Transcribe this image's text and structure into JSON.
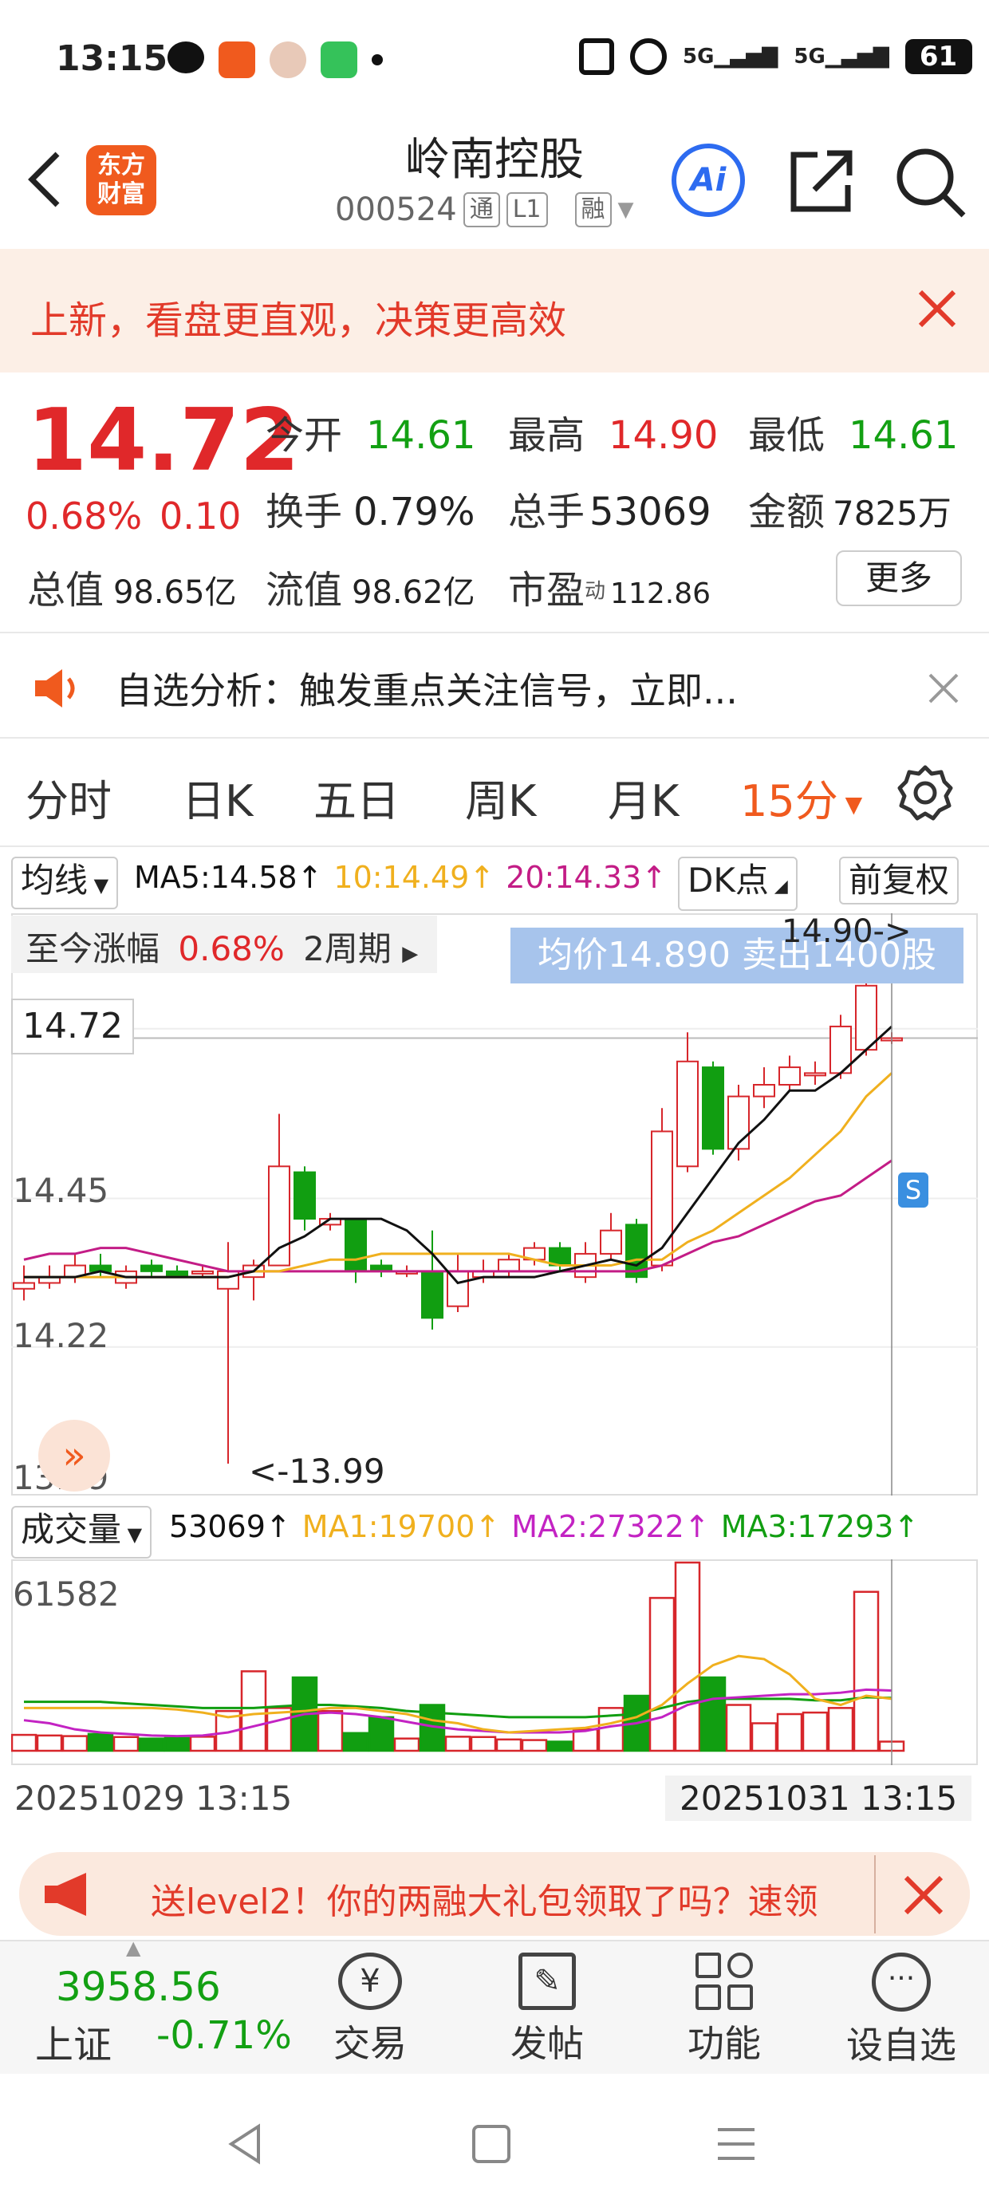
{
  "status_bar": {
    "time": "13:15",
    "battery": "61",
    "network1": "5G",
    "network2": "5G"
  },
  "header": {
    "title": "岭南控股",
    "code": "000524",
    "tag1": "通",
    "tag2": "L1",
    "tag3": "融",
    "ai_label": "Ai",
    "logo_text1": "东方",
    "logo_text2": "财富"
  },
  "promo": {
    "text": "上新，看盘更直观，决策更高效"
  },
  "quote": {
    "price": "14.72",
    "change_pct": "0.68%",
    "change": "0.10",
    "open_label": "今开",
    "open": "14.61",
    "high_label": "最高",
    "high": "14.90",
    "low_label": "最低",
    "low": "14.61",
    "turnover_label": "换手",
    "turnover": "0.79%",
    "volume_label": "总手",
    "volume": "53069",
    "amount_label": "金额",
    "amount": "7825万",
    "mktcap_label": "总值",
    "mktcap": "98.65亿",
    "float_label": "流值",
    "float": "98.62亿",
    "pe_label": "市盈",
    "pe_sup": "动",
    "pe": "112.86",
    "more_label": "更多"
  },
  "notice": {
    "text": "自选分析：触发重点关注信号，立即..."
  },
  "tabs": [
    {
      "label": "分时"
    },
    {
      "label": "日K"
    },
    {
      "label": "五日"
    },
    {
      "label": "周K"
    },
    {
      "label": "月K"
    },
    {
      "label": "15分"
    }
  ],
  "indicator_row": {
    "ma_btn": "均线",
    "ma5": "MA5:14.58↑",
    "ma10": "10:14.49↑",
    "ma20": "20:14.33↑",
    "dk_btn": "DK点",
    "adjust_btn": "前复权"
  },
  "chart": {
    "range_label": "至今涨幅",
    "range_pct": "0.68%",
    "range_period": "2周期",
    "avg_tip": "均价14.890  卖出1400股",
    "high_marker": "14.90->",
    "low_marker": "<-13.99",
    "last_price": "14.72",
    "y_labels": [
      "14.45",
      "14.22",
      "13.99"
    ],
    "s_marker": "S"
  },
  "volume_row": {
    "btn": "成交量",
    "vol": "53069↑",
    "ma1": "MA1:19700↑",
    "ma2": "MA2:27322↑",
    "ma3": "MA3:17293↑",
    "y_max": "61582"
  },
  "dates": {
    "start": "20251029 13:15",
    "end": "20251031 13:15"
  },
  "chart_data": {
    "type": "candlestick",
    "interval": "15分",
    "ylim": [
      13.99,
      14.9
    ],
    "candles": [
      {
        "o": 14.29,
        "c": 14.3,
        "h": 14.33,
        "l": 14.27
      },
      {
        "o": 14.3,
        "c": 14.31,
        "h": 14.33,
        "l": 14.29
      },
      {
        "o": 14.31,
        "c": 14.33,
        "h": 14.35,
        "l": 14.3
      },
      {
        "o": 14.33,
        "c": 14.32,
        "h": 14.35,
        "l": 14.31
      },
      {
        "o": 14.3,
        "c": 14.32,
        "h": 14.33,
        "l": 14.29
      },
      {
        "o": 14.33,
        "c": 14.32,
        "h": 14.34,
        "l": 14.31
      },
      {
        "o": 14.32,
        "c": 14.31,
        "h": 14.33,
        "l": 14.31
      },
      {
        "o": 14.32,
        "c": 14.32,
        "h": 14.33,
        "l": 14.31
      },
      {
        "o": 14.29,
        "c": 14.32,
        "h": 14.37,
        "l": 13.99
      },
      {
        "o": 14.31,
        "c": 14.33,
        "h": 14.34,
        "l": 14.27
      },
      {
        "o": 14.33,
        "c": 14.5,
        "h": 14.59,
        "l": 14.33
      },
      {
        "o": 14.49,
        "c": 14.41,
        "h": 14.5,
        "l": 14.39
      },
      {
        "o": 14.4,
        "c": 14.41,
        "h": 14.42,
        "l": 14.39
      },
      {
        "o": 14.41,
        "c": 14.32,
        "h": 14.41,
        "l": 14.3
      },
      {
        "o": 14.33,
        "c": 14.32,
        "h": 14.34,
        "l": 14.31
      },
      {
        "o": 14.32,
        "c": 14.32,
        "h": 14.33,
        "l": 14.31
      },
      {
        "o": 14.32,
        "c": 14.24,
        "h": 14.39,
        "l": 14.22
      },
      {
        "o": 14.26,
        "c": 14.32,
        "h": 14.35,
        "l": 14.25
      },
      {
        "o": 14.31,
        "c": 14.32,
        "h": 14.34,
        "l": 14.3
      },
      {
        "o": 14.32,
        "c": 14.34,
        "h": 14.35,
        "l": 14.31
      },
      {
        "o": 14.34,
        "c": 14.36,
        "h": 14.37,
        "l": 14.33
      },
      {
        "o": 14.36,
        "c": 14.33,
        "h": 14.37,
        "l": 14.32
      },
      {
        "o": 14.31,
        "c": 14.35,
        "h": 14.37,
        "l": 14.3
      },
      {
        "o": 14.35,
        "c": 14.39,
        "h": 14.42,
        "l": 14.34
      },
      {
        "o": 14.4,
        "c": 14.31,
        "h": 14.41,
        "l": 14.3
      },
      {
        "o": 14.33,
        "c": 14.56,
        "h": 14.6,
        "l": 14.32
      },
      {
        "o": 14.5,
        "c": 14.68,
        "h": 14.73,
        "l": 14.49
      },
      {
        "o": 14.67,
        "c": 14.53,
        "h": 14.68,
        "l": 14.52
      },
      {
        "o": 14.53,
        "c": 14.62,
        "h": 14.64,
        "l": 14.51
      },
      {
        "o": 14.62,
        "c": 14.64,
        "h": 14.67,
        "l": 14.6
      },
      {
        "o": 14.64,
        "c": 14.67,
        "h": 14.69,
        "l": 14.63
      },
      {
        "o": 14.66,
        "c": 14.66,
        "h": 14.68,
        "l": 14.64
      },
      {
        "o": 14.66,
        "c": 14.74,
        "h": 14.76,
        "l": 14.65
      },
      {
        "o": 14.7,
        "c": 14.81,
        "h": 14.9,
        "l": 14.69
      },
      {
        "o": 14.72,
        "c": 14.72,
        "h": 14.73,
        "l": 14.71
      }
    ],
    "ma5": [
      14.31,
      14.31,
      14.31,
      14.32,
      14.31,
      14.31,
      14.31,
      14.31,
      14.31,
      14.32,
      14.36,
      14.38,
      14.41,
      14.41,
      14.41,
      14.39,
      14.35,
      14.3,
      14.31,
      14.31,
      14.31,
      14.32,
      14.33,
      14.34,
      14.33,
      14.36,
      14.42,
      14.48,
      14.54,
      14.58,
      14.63,
      14.63,
      14.66,
      14.7,
      14.74
    ],
    "ma10": [
      14.31,
      14.31,
      14.31,
      14.31,
      14.31,
      14.31,
      14.31,
      14.31,
      14.31,
      14.32,
      14.32,
      14.33,
      14.34,
      14.34,
      14.35,
      14.35,
      14.35,
      14.35,
      14.35,
      14.35,
      14.34,
      14.33,
      14.33,
      14.33,
      14.34,
      14.34,
      14.37,
      14.39,
      14.42,
      14.45,
      14.48,
      14.52,
      14.56,
      14.62,
      14.66
    ],
    "ma20": [
      14.34,
      14.35,
      14.35,
      14.36,
      14.36,
      14.35,
      14.34,
      14.33,
      14.32,
      14.32,
      14.32,
      14.32,
      14.32,
      14.32,
      14.32,
      14.32,
      14.32,
      14.32,
      14.32,
      14.32,
      14.32,
      14.32,
      14.32,
      14.32,
      14.32,
      14.33,
      14.35,
      14.37,
      14.38,
      14.4,
      14.42,
      14.44,
      14.45,
      14.48,
      14.51
    ],
    "volume": [
      5200,
      5000,
      4800,
      5500,
      4500,
      4000,
      4200,
      4600,
      13000,
      26000,
      14000,
      24000,
      13000,
      5800,
      11000,
      4000,
      15000,
      4600,
      4500,
      3700,
      3500,
      3000,
      7000,
      14000,
      18000,
      50000,
      61582,
      24000,
      15000,
      9000,
      12000,
      12500,
      14000,
      52000,
      3000
    ],
    "volume_ylim": [
      0,
      61582
    ],
    "vol_ma1": [
      14000,
      14000,
      14000,
      14000,
      14000,
      14000,
      13500,
      12500,
      11000,
      12000,
      12500,
      13000,
      14000,
      14000,
      13000,
      12000,
      10000,
      9000,
      7000,
      6000,
      6500,
      7000,
      7500,
      9000,
      11000,
      15000,
      22000,
      28000,
      31000,
      30000,
      25000,
      17000,
      15000,
      18000,
      17000
    ],
    "vol_ma2": [
      10000,
      9000,
      7000,
      6000,
      5500,
      5000,
      4800,
      5000,
      6000,
      8000,
      10000,
      12000,
      12500,
      12000,
      11000,
      9500,
      8000,
      7000,
      6500,
      6000,
      6000,
      6000,
      6500,
      8000,
      9000,
      11000,
      15000,
      17000,
      17500,
      18000,
      18500,
      18500,
      19000,
      20000,
      19700
    ],
    "vol_ma3": [
      16000,
      16000,
      16000,
      16000,
      15500,
      15000,
      14500,
      14000,
      14000,
      14000,
      14500,
      15000,
      15000,
      14500,
      14000,
      13000,
      12500,
      12000,
      11500,
      11000,
      11000,
      11000,
      11000,
      11500,
      12000,
      14000,
      16000,
      17000,
      17000,
      17000,
      17000,
      16500,
      16500,
      17500,
      17293
    ],
    "colors": {
      "up": "#d7262b",
      "down": "#119e11",
      "ma5": "#111111",
      "ma10": "#f0b01e",
      "ma20": "#c31c86",
      "vol_ma1": "#f0b01e",
      "vol_ma2": "#c323c3",
      "vol_ma3": "#119e11"
    }
  },
  "bottom_promo": {
    "text": "送level2！你的两融大礼包领取了吗？速领"
  },
  "bottom_nav": {
    "index_value": "3958.56",
    "index_name": "上证",
    "index_change": "-0.71%",
    "trade": "交易",
    "post": "发帖",
    "functions": "功能",
    "add": "设自选"
  }
}
